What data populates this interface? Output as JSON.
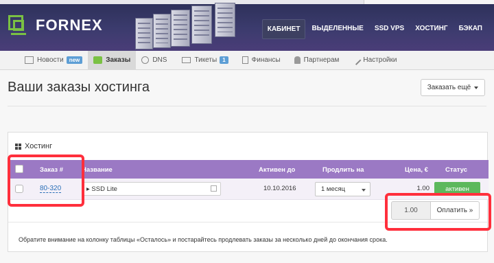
{
  "brand": {
    "name": "FORNEX"
  },
  "top_nav": [
    "КАБИНЕТ",
    "ВЫДЕЛЕННЫЕ",
    "SSD VPS",
    "ХОСТИНГ",
    "БЭКАП"
  ],
  "sub_nav": [
    {
      "label": "Новости",
      "icon": "news-icon",
      "badge": "new"
    },
    {
      "label": "Заказы",
      "icon": "orders-icon",
      "active": true
    },
    {
      "label": "DNS",
      "icon": "globe-icon"
    },
    {
      "label": "Тикеты",
      "icon": "envelope-icon",
      "badge": "1"
    },
    {
      "label": "Финансы",
      "icon": "calculator-icon"
    },
    {
      "label": "Партнерам",
      "icon": "person-icon"
    },
    {
      "label": "Настройки",
      "icon": "wrench-icon"
    }
  ],
  "page": {
    "title": "Ваши заказы хостинга",
    "order_more": "Заказать ещё"
  },
  "panel": {
    "title": "Хостинг",
    "columns": [
      "Заказ #",
      "Название",
      "Активен до",
      "Продлить на",
      "Цена, €",
      "Статус"
    ],
    "row": {
      "order_id": "80-320",
      "name": "▸ SSD Lite",
      "active_until": "10.10.2016",
      "extend": "1 месяц",
      "price": "1.00",
      "status": "активен"
    },
    "pay_amount": "1.00",
    "pay_label": "Оплатить »",
    "note": "Обратите внимание на колонку таблицы «Осталось» и постарайтесь продлевать заказы за несколько дней до окончания срока."
  },
  "colors": {
    "accent": "#9b79c4",
    "status": "#5cb85c",
    "highlight": "#ff2f3c",
    "logo": "#7ac143"
  }
}
